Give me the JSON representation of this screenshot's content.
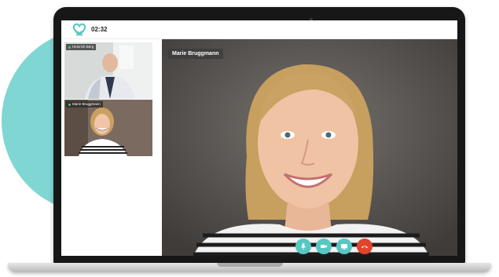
{
  "app": {
    "timer": "02:32",
    "accent_color": "#58c7c3",
    "hangup_color": "#e0452c"
  },
  "participants": [
    {
      "name": "Heinrich Berg",
      "role": "thumbnail"
    },
    {
      "name": "Marie Bruggmann",
      "role": "thumbnail"
    }
  ],
  "main_video": {
    "speaker_name": "Marie Bruggmann"
  },
  "controls": [
    {
      "icon": "microphone-icon"
    },
    {
      "icon": "video-camera-icon"
    },
    {
      "icon": "screen-share-icon"
    },
    {
      "icon": "hang-up-icon"
    }
  ]
}
